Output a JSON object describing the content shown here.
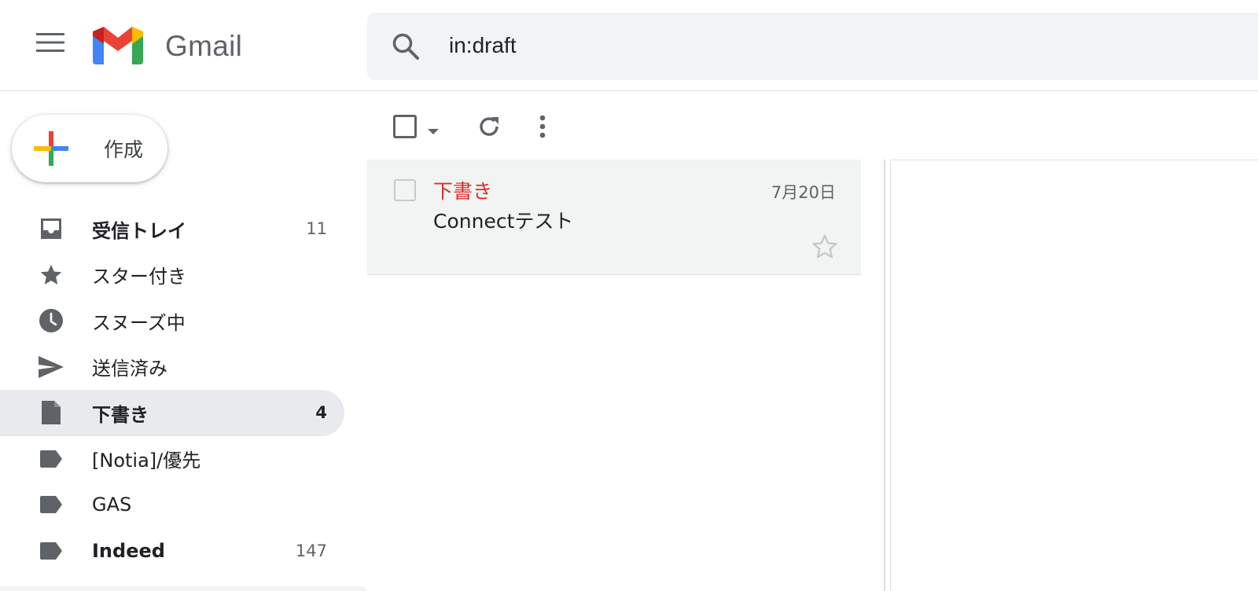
{
  "header": {
    "app_name": "Gmail",
    "menu_icon": "hamburger-menu-icon",
    "logo_icon": "gmail-m-logo",
    "search": {
      "value": "in:draft",
      "icon": "search-icon"
    }
  },
  "compose": {
    "label": "作成",
    "icon": "plus-multicolor-icon"
  },
  "sidebar": {
    "items": [
      {
        "label": "受信トレイ",
        "count": "11",
        "icon": "inbox-icon",
        "bold": true,
        "active": false
      },
      {
        "label": "スター付き",
        "count": "",
        "icon": "star-icon",
        "bold": false,
        "active": false
      },
      {
        "label": "スヌーズ中",
        "count": "",
        "icon": "clock-icon",
        "bold": false,
        "active": false
      },
      {
        "label": "送信済み",
        "count": "",
        "icon": "send-icon",
        "bold": false,
        "active": false
      },
      {
        "label": "下書き",
        "count": "4",
        "icon": "draft-file-icon",
        "bold": true,
        "active": true
      },
      {
        "label": "[Notia]/優先",
        "count": "",
        "icon": "label-icon",
        "bold": false,
        "active": false
      },
      {
        "label": "GAS",
        "count": "",
        "icon": "label-icon",
        "bold": false,
        "active": false
      },
      {
        "label": "Indeed",
        "count": "147",
        "icon": "label-icon",
        "bold": true,
        "active": false
      }
    ]
  },
  "toolbar": {
    "select_icon": "checkbox-icon",
    "caret_icon": "caret-down-icon",
    "refresh_icon": "refresh-icon",
    "more_icon": "more-vert-icon"
  },
  "messages": [
    {
      "sender": "下書き",
      "date": "7月20日",
      "subject": "Connectテスト",
      "starred": false
    }
  ],
  "colors": {
    "accent_red": "#d93025",
    "active_bg": "#e8eaed",
    "search_bg": "#f1f3f4",
    "icon_gray": "#5f6368"
  }
}
